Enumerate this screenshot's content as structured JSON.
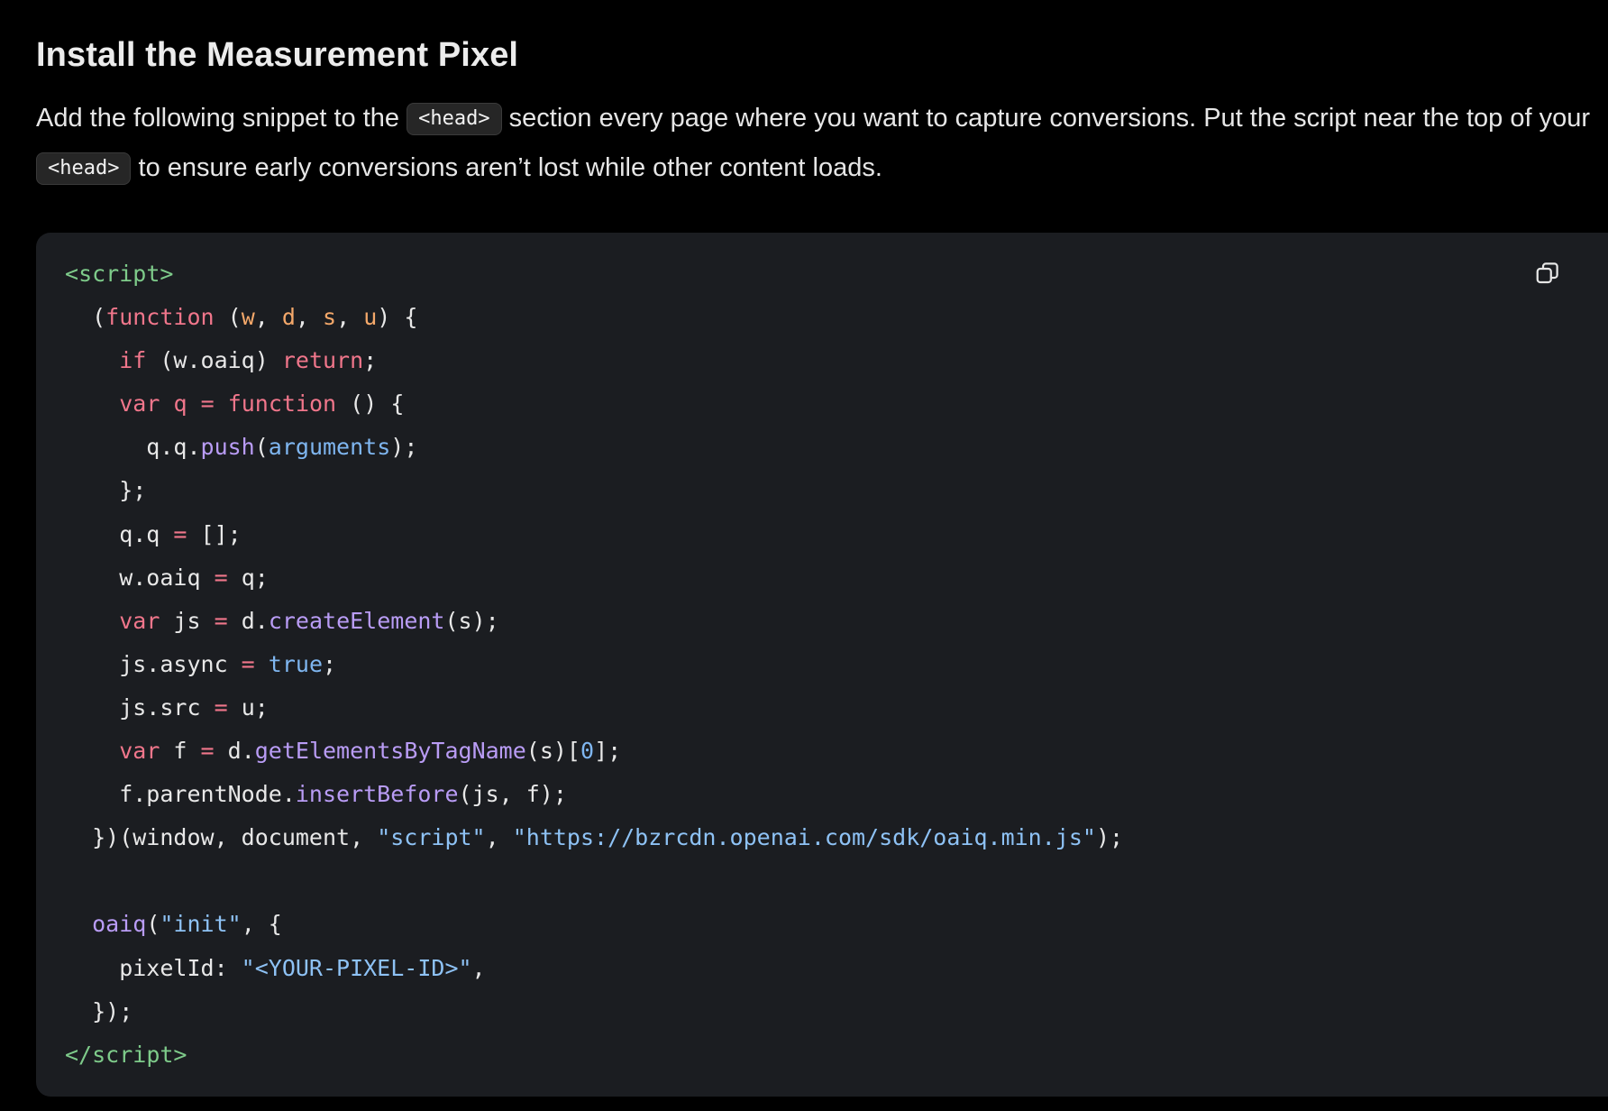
{
  "section": {
    "title": "Install the Measurement Pixel",
    "intro_part1": "Add the following snippet to the ",
    "intro_code1": "<head>",
    "intro_part2": " section every page where you want to capture conversions. Put the script near the top of your ",
    "intro_code2": "<head>",
    "intro_part3": " to ensure early conversions aren’t lost while other content loads."
  },
  "code_block": {
    "copy_icon": "copy-icon",
    "lines": [
      [
        [
          "tag",
          "<"
        ],
        [
          "tag",
          "script"
        ],
        [
          "tag",
          ">"
        ]
      ],
      [
        [
          "plain",
          "  ("
        ],
        [
          "kw",
          "function"
        ],
        [
          "plain",
          " ("
        ],
        [
          "param",
          "w"
        ],
        [
          "plain",
          ", "
        ],
        [
          "param",
          "d"
        ],
        [
          "plain",
          ", "
        ],
        [
          "param",
          "s"
        ],
        [
          "plain",
          ", "
        ],
        [
          "param",
          "u"
        ],
        [
          "plain",
          ") {"
        ]
      ],
      [
        [
          "plain",
          "    "
        ],
        [
          "kw",
          "if"
        ],
        [
          "plain",
          " (w.oaiq) "
        ],
        [
          "kw",
          "return"
        ],
        [
          "plain",
          ";"
        ]
      ],
      [
        [
          "plain",
          "    "
        ],
        [
          "kw",
          "var"
        ],
        [
          "plain",
          " "
        ],
        [
          "kw",
          "q"
        ],
        [
          "plain",
          " "
        ],
        [
          "op",
          "="
        ],
        [
          "plain",
          " "
        ],
        [
          "kw",
          "function"
        ],
        [
          "plain",
          " () {"
        ]
      ],
      [
        [
          "plain",
          "      q.q."
        ],
        [
          "fn",
          "push"
        ],
        [
          "plain",
          "("
        ],
        [
          "builtin",
          "arguments"
        ],
        [
          "plain",
          ");"
        ]
      ],
      [
        [
          "plain",
          "    };"
        ]
      ],
      [
        [
          "plain",
          "    q.q "
        ],
        [
          "op",
          "="
        ],
        [
          "plain",
          " [];"
        ]
      ],
      [
        [
          "plain",
          "    w.oaiq "
        ],
        [
          "op",
          "="
        ],
        [
          "plain",
          " q;"
        ]
      ],
      [
        [
          "plain",
          "    "
        ],
        [
          "kw",
          "var"
        ],
        [
          "plain",
          " js "
        ],
        [
          "op",
          "="
        ],
        [
          "plain",
          " d."
        ],
        [
          "fn",
          "createElement"
        ],
        [
          "plain",
          "(s);"
        ]
      ],
      [
        [
          "plain",
          "    js.async "
        ],
        [
          "op",
          "="
        ],
        [
          "plain",
          " "
        ],
        [
          "builtin",
          "true"
        ],
        [
          "plain",
          ";"
        ]
      ],
      [
        [
          "plain",
          "    js.src "
        ],
        [
          "op",
          "="
        ],
        [
          "plain",
          " u;"
        ]
      ],
      [
        [
          "plain",
          "    "
        ],
        [
          "kw",
          "var"
        ],
        [
          "plain",
          " f "
        ],
        [
          "op",
          "="
        ],
        [
          "plain",
          " d."
        ],
        [
          "fn",
          "getElementsByTagName"
        ],
        [
          "plain",
          "(s)["
        ],
        [
          "num",
          "0"
        ],
        [
          "plain",
          "];"
        ]
      ],
      [
        [
          "plain",
          "    f.parentNode."
        ],
        [
          "fn",
          "insertBefore"
        ],
        [
          "plain",
          "(js, f);"
        ]
      ],
      [
        [
          "plain",
          "  })(window, document, "
        ],
        [
          "str",
          "\"script\""
        ],
        [
          "plain",
          ", "
        ],
        [
          "str",
          "\"https://bzrcdn.openai.com/sdk/oaiq.min.js\""
        ],
        [
          "plain",
          ");"
        ]
      ],
      [
        [
          "plain",
          ""
        ]
      ],
      [
        [
          "plain",
          "  "
        ],
        [
          "fn",
          "oaiq"
        ],
        [
          "plain",
          "("
        ],
        [
          "str",
          "\"init\""
        ],
        [
          "plain",
          ", {"
        ]
      ],
      [
        [
          "plain",
          "    pixelId: "
        ],
        [
          "str",
          "\"<YOUR-PIXEL-ID>\""
        ],
        [
          "plain",
          ","
        ]
      ],
      [
        [
          "plain",
          "  });"
        ]
      ],
      [
        [
          "tag",
          "</"
        ],
        [
          "tag",
          "script"
        ],
        [
          "tag",
          ">"
        ]
      ]
    ]
  },
  "colors": {
    "background": "#000000",
    "code_background": "#1b1d21",
    "keyword": "#f0768b",
    "param": "#f4a86a",
    "function": "#b99cf5",
    "string": "#8ec2f5",
    "tag": "#7ecb8a"
  }
}
